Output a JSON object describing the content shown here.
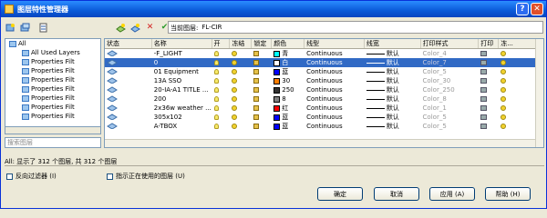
{
  "window": {
    "title": "图层特性管理器",
    "help_label": "?",
    "close_label": "✕"
  },
  "toolbar": {
    "left_tools": [
      "new-filter-icon",
      "group-filter-icon",
      "state-manager-icon"
    ],
    "right_tools": [
      "new-layer-icon",
      "new-vp-freeze-layer-icon",
      "delete-layer-icon",
      "set-current-icon"
    ],
    "current_layer_label": "当前图层:",
    "current_layer_value": "FL-CIR"
  },
  "tree": {
    "items": [
      {
        "label": "All",
        "level": 0
      },
      {
        "label": "All Used Layers",
        "level": 1
      },
      {
        "label": "Properties Filt",
        "level": 1
      },
      {
        "label": "Properties Filt",
        "level": 1
      },
      {
        "label": "Properties Filt",
        "level": 1
      },
      {
        "label": "Properties Filt",
        "level": 1
      },
      {
        "label": "Properties Filt",
        "level": 1
      },
      {
        "label": "Properties Filt",
        "level": 1
      },
      {
        "label": "Properties Filt",
        "level": 1
      }
    ],
    "search_placeholder": "搜索图层"
  },
  "grid": {
    "columns": [
      "状态",
      "名称",
      "开",
      "冻结",
      "锁定",
      "颜色",
      "线型",
      "线宽",
      "打印样式",
      "打印",
      "冻..."
    ],
    "rows": [
      {
        "name": "-F_LIGHT",
        "color_name": "青",
        "color_hex": "#00ffff",
        "linetype": "Continuous",
        "lineweight": "默认",
        "plotstyle": "Color_4",
        "selected": false
      },
      {
        "name": "0",
        "color_name": "白",
        "color_hex": "#ffffff",
        "linetype": "Continuous",
        "lineweight": "默认",
        "plotstyle": "Color_7",
        "selected": true
      },
      {
        "name": "01 Equipment",
        "color_name": "蓝",
        "color_hex": "#0000ff",
        "linetype": "Continuous",
        "lineweight": "默认",
        "plotstyle": "Color_5",
        "selected": false
      },
      {
        "name": "13A SSO",
        "color_name": "30",
        "color_hex": "#ff7f00",
        "linetype": "Continuous",
        "lineweight": "默认",
        "plotstyle": "Color_30",
        "selected": false
      },
      {
        "name": "20-IA-A1 TITLE ...",
        "color_name": "250",
        "color_hex": "#333333",
        "linetype": "Continuous",
        "lineweight": "默认",
        "plotstyle": "Color_250",
        "selected": false
      },
      {
        "name": "200",
        "color_name": "8",
        "color_hex": "#808080",
        "linetype": "Continuous",
        "lineweight": "默认",
        "plotstyle": "Color_8",
        "selected": false
      },
      {
        "name": "2x36w weather ...",
        "color_name": "红",
        "color_hex": "#ff0000",
        "linetype": "Continuous",
        "lineweight": "默认",
        "plotstyle": "Color_1",
        "selected": false
      },
      {
        "name": "305x102",
        "color_name": "蓝",
        "color_hex": "#0000ff",
        "linetype": "Continuous",
        "lineweight": "默认",
        "plotstyle": "Color_5",
        "selected": false
      },
      {
        "name": "A-TBOX",
        "color_name": "蓝",
        "color_hex": "#0000ff",
        "linetype": "Continuous",
        "lineweight": "默认",
        "plotstyle": "Color_5",
        "selected": false
      }
    ]
  },
  "status_text": "All: 显示了 312 个图层, 共 312 个图层",
  "checkboxes": {
    "invert_filter": "反向过滤器 (I)",
    "indicate_used": "指示正在使用的图层 (U)"
  },
  "buttons": {
    "ok": "确定",
    "cancel": "取消",
    "apply": "应用 (A)",
    "help": "帮助 (H)"
  }
}
